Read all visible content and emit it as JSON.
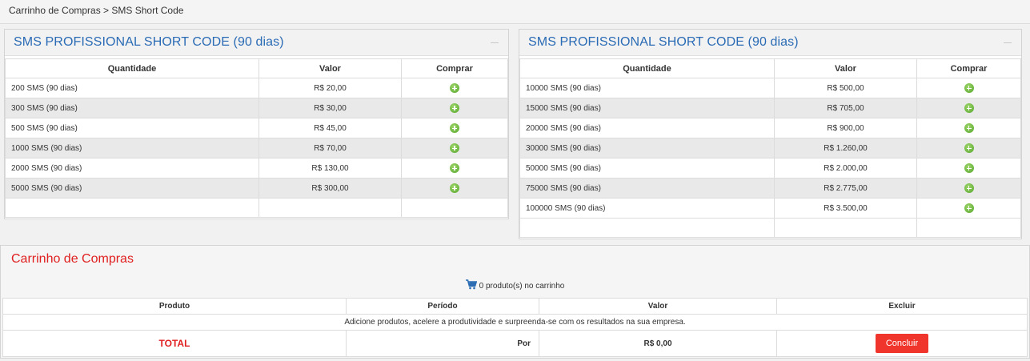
{
  "breadcrumb": "Carrinho de Compras > SMS Short Code",
  "headers": {
    "quantidade": "Quantidade",
    "valor": "Valor",
    "comprar": "Comprar"
  },
  "panel_left": {
    "title": "SMS PROFISSIONAL SHORT CODE (90 dias)",
    "rows": [
      {
        "qty": "200 SMS (90 dias)",
        "price": "R$ 20,00"
      },
      {
        "qty": "300 SMS (90 dias)",
        "price": "R$ 30,00"
      },
      {
        "qty": "500 SMS (90 dias)",
        "price": "R$ 45,00"
      },
      {
        "qty": "1000 SMS (90 dias)",
        "price": "R$ 70,00"
      },
      {
        "qty": "2000 SMS (90 dias)",
        "price": "R$ 130,00"
      },
      {
        "qty": "5000 SMS (90 dias)",
        "price": "R$ 300,00"
      }
    ]
  },
  "panel_right": {
    "title": "SMS PROFISSIONAL SHORT CODE (90 dias)",
    "rows": [
      {
        "qty": "10000 SMS (90 dias)",
        "price": "R$ 500,00"
      },
      {
        "qty": "15000 SMS (90 dias)",
        "price": "R$ 705,00"
      },
      {
        "qty": "20000 SMS (90 dias)",
        "price": "R$ 900,00"
      },
      {
        "qty": "30000 SMS (90 dias)",
        "price": "R$ 1.260,00"
      },
      {
        "qty": "50000 SMS (90 dias)",
        "price": "R$ 2.000,00"
      },
      {
        "qty": "75000 SMS (90 dias)",
        "price": "R$ 2.775,00"
      },
      {
        "qty": "100000 SMS (90 dias)",
        "price": "R$ 3.500,00"
      }
    ]
  },
  "cart": {
    "title": "Carrinho de Compras",
    "count_text": "0 produto(s) no carrinho",
    "columns": {
      "produto": "Produto",
      "periodo": "Período",
      "valor": "Valor",
      "excluir": "Excluir"
    },
    "empty_message": "Adicione produtos, acelere a produtividade e surpreenda-se com os resultados na sua empresa.",
    "total_label": "TOTAL",
    "por_label": "Por",
    "total_value": "R$ 0,00",
    "conclude_label": "Concluir"
  },
  "colors": {
    "title_blue": "#2a6bb5",
    "cart_red": "#e02020",
    "button_red": "#f0362c",
    "add_green": "#54a52c"
  },
  "icons": {
    "add": "plus-circle-icon",
    "cart": "shopping-cart-icon",
    "collapse": "minus-icon"
  }
}
